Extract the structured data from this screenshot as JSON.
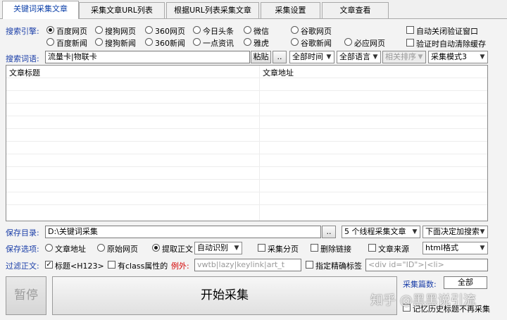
{
  "tabs": [
    {
      "label": "关键词采集文章",
      "active": true
    },
    {
      "label": "采集文章URL列表",
      "active": false
    },
    {
      "label": "根据URL列表采集文章",
      "active": false
    },
    {
      "label": "采集设置",
      "active": false
    },
    {
      "label": "文章查看",
      "active": false
    }
  ],
  "engine": {
    "label": "搜索引擎:",
    "options": [
      {
        "label": "百度网页",
        "checked": true
      },
      {
        "label": "搜狗网页",
        "checked": false
      },
      {
        "label": "360网页",
        "checked": false
      },
      {
        "label": "今日头条",
        "checked": false
      },
      {
        "label": "微信",
        "checked": false
      },
      {
        "label": "谷歌网页",
        "checked": false
      },
      {
        "label": "百度新闻",
        "checked": false
      },
      {
        "label": "搜狗新闻",
        "checked": false
      },
      {
        "label": "360新闻",
        "checked": false
      },
      {
        "label": "一点资讯",
        "checked": false
      },
      {
        "label": "雅虎",
        "checked": false
      },
      {
        "label": "谷歌新闻",
        "checked": false
      },
      {
        "label": "必应网页",
        "checked": false
      }
    ],
    "check_close_captcha": "自动关闭验证窗口",
    "check_clear_cache": "验证时自动清除缓存"
  },
  "keyword": {
    "label": "搜索词语:",
    "value": "流量卡|物联卡",
    "paste_label": "粘贴",
    "more_label": "..",
    "time_select": "全部时间",
    "lang_select": "全部语言",
    "sort_select": "相关排序",
    "mode_select": "采集模式3"
  },
  "table": {
    "col_title": "文章标题",
    "col_url": "文章地址"
  },
  "save_dir": {
    "label": "保存目录:",
    "value": "D:\\关键词采集",
    "more_label": "..",
    "threads_select": "5 个线程采集文章",
    "decide_select": "下面决定加搜索"
  },
  "save_options": {
    "label": "保存选项:",
    "opt_url": "文章地址",
    "opt_raw": "原始网页",
    "opt_extract": "提取正文",
    "auto_select": "自动识别",
    "check_paging": "采集分页",
    "check_remove_links": "删除链接",
    "check_source": "文章来源",
    "format_select": "html格式"
  },
  "filter": {
    "label": "过滤正文:",
    "check_title": "标题<H123>",
    "check_class": "有class属性的",
    "exception_label": "例外:",
    "exception_value": "vwtb|lazy|keylink|art_t",
    "check_exact": "指定精确标签",
    "tag_placeholder": "<div id=\"ID\">|<li>"
  },
  "bottom": {
    "pause_label": "暂停",
    "start_label": "开始采集",
    "count_label": "采集篇数:",
    "count_value": "全部",
    "check_history": "记忆历史标题不再采集"
  },
  "watermark": "知乎 @黑黑说引流"
}
